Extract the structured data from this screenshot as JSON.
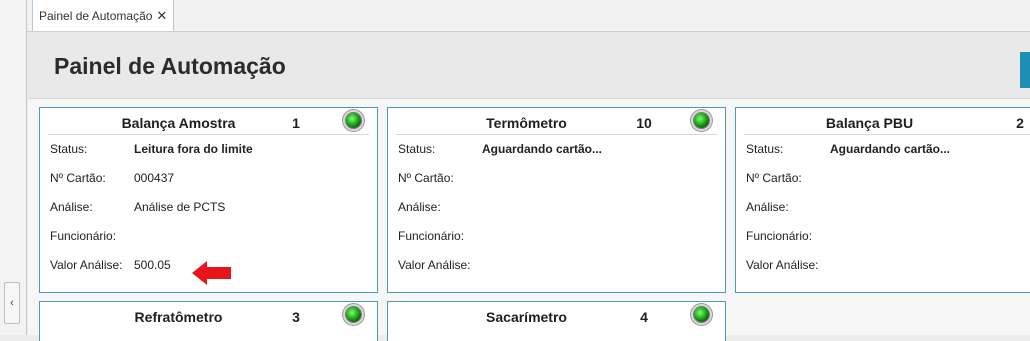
{
  "tab": {
    "label": "Painel de Automação",
    "close_glyph": "✕"
  },
  "sidebar": {
    "collapse_glyph": "‹"
  },
  "page": {
    "title": "Painel de Automação"
  },
  "labels": {
    "status": "Status:",
    "card": "Nº Cartão:",
    "analysis": "Análise:",
    "employee": "Funcionário:",
    "analysis_value": "Valor Análise:"
  },
  "panels": [
    {
      "name": "Balança Amostra",
      "number": "1",
      "status": "Leitura fora do limite",
      "card": "000437",
      "analysis": "Análise de PCTS",
      "employee": "",
      "analysis_value": "500.05",
      "led_color": "#1fa81b"
    },
    {
      "name": "Termômetro",
      "number": "10",
      "status": "Aguardando cartão...",
      "card": "",
      "analysis": "",
      "employee": "",
      "analysis_value": "",
      "led_color": "#1fa81b"
    },
    {
      "name": "Balança PBU",
      "number": "2",
      "status": "Aguardando cartão...",
      "card": "",
      "analysis": "",
      "employee": "",
      "analysis_value": "",
      "led_color": "#1fa81b"
    },
    {
      "name": "Refratômetro",
      "number": "3",
      "led_color": "#1fa81b"
    },
    {
      "name": "Sacarímetro",
      "number": "4",
      "led_color": "#1fa81b"
    }
  ],
  "colors": {
    "panel_border": "#4a9ab7",
    "arrow": "#e8141b",
    "accent": "#1d8fb5"
  }
}
